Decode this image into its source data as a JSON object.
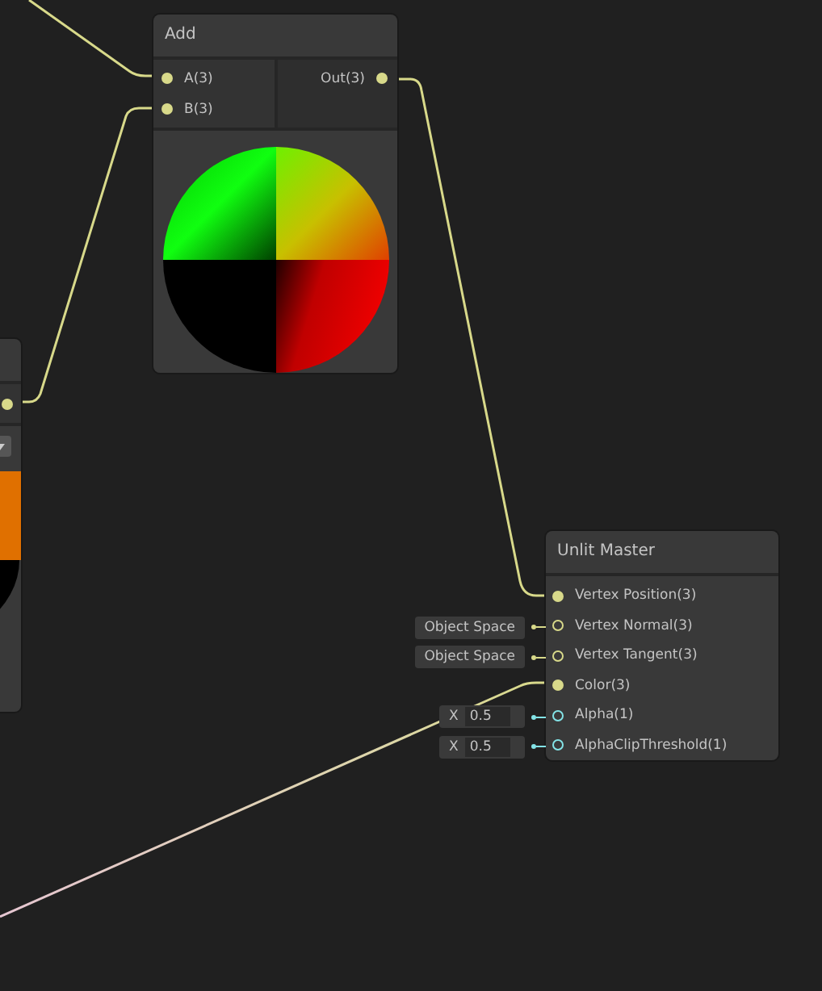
{
  "nodes": [
    {
      "kind": "partial",
      "ports": [
        {
          "color": "#d8d98a",
          "connected": true
        }
      ],
      "has_dropdown": true
    },
    {
      "kind": "operation",
      "title": "Add",
      "inputs": [
        {
          "label": "A(3)",
          "color": "#d8d98a",
          "connected": true
        },
        {
          "label": "B(3)",
          "color": "#d8d98a",
          "connected": true
        }
      ],
      "outputs": [
        {
          "label": "Out(3)",
          "color": "#d8d98a",
          "connected": true
        }
      ]
    },
    {
      "kind": "master",
      "title": "Unlit Master",
      "ports": [
        {
          "label": "Vertex Position(3)",
          "color": "#d8d98a",
          "connected": true
        },
        {
          "label": "Vertex Normal(3)",
          "color": "#d8d98a",
          "connected": false,
          "default": {
            "kind": "space",
            "text": "Object Space"
          }
        },
        {
          "label": "Vertex Tangent(3)",
          "color": "#d8d98a",
          "connected": false,
          "default": {
            "kind": "space",
            "text": "Object Space"
          }
        },
        {
          "label": "Color(3)",
          "color": "#d8d98a",
          "connected": true
        },
        {
          "label": "Alpha(1)",
          "color": "#84e4e7",
          "connected": false,
          "default": {
            "kind": "value",
            "axis": "X",
            "value": "0.5"
          }
        },
        {
          "label": "AlphaClipThreshold(1)",
          "color": "#84e4e7",
          "connected": false,
          "default": {
            "kind": "value",
            "axis": "X",
            "value": "0.5"
          }
        }
      ]
    }
  ]
}
